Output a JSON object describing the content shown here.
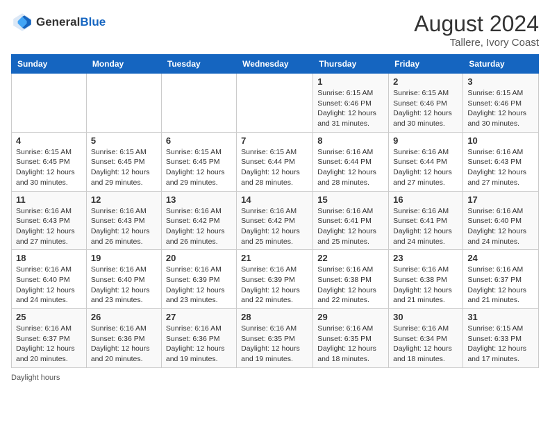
{
  "header": {
    "logo_general": "General",
    "logo_blue": "Blue",
    "month_year": "August 2024",
    "location": "Tallere, Ivory Coast"
  },
  "footer": {
    "daylight_label": "Daylight hours"
  },
  "days_of_week": [
    "Sunday",
    "Monday",
    "Tuesday",
    "Wednesday",
    "Thursday",
    "Friday",
    "Saturday"
  ],
  "weeks": [
    [
      {
        "day": "",
        "detail": ""
      },
      {
        "day": "",
        "detail": ""
      },
      {
        "day": "",
        "detail": ""
      },
      {
        "day": "",
        "detail": ""
      },
      {
        "day": "1",
        "detail": "Sunrise: 6:15 AM\nSunset: 6:46 PM\nDaylight: 12 hours and 31 minutes."
      },
      {
        "day": "2",
        "detail": "Sunrise: 6:15 AM\nSunset: 6:46 PM\nDaylight: 12 hours and 30 minutes."
      },
      {
        "day": "3",
        "detail": "Sunrise: 6:15 AM\nSunset: 6:46 PM\nDaylight: 12 hours and 30 minutes."
      }
    ],
    [
      {
        "day": "4",
        "detail": "Sunrise: 6:15 AM\nSunset: 6:45 PM\nDaylight: 12 hours and 30 minutes."
      },
      {
        "day": "5",
        "detail": "Sunrise: 6:15 AM\nSunset: 6:45 PM\nDaylight: 12 hours and 29 minutes."
      },
      {
        "day": "6",
        "detail": "Sunrise: 6:15 AM\nSunset: 6:45 PM\nDaylight: 12 hours and 29 minutes."
      },
      {
        "day": "7",
        "detail": "Sunrise: 6:15 AM\nSunset: 6:44 PM\nDaylight: 12 hours and 28 minutes."
      },
      {
        "day": "8",
        "detail": "Sunrise: 6:16 AM\nSunset: 6:44 PM\nDaylight: 12 hours and 28 minutes."
      },
      {
        "day": "9",
        "detail": "Sunrise: 6:16 AM\nSunset: 6:44 PM\nDaylight: 12 hours and 27 minutes."
      },
      {
        "day": "10",
        "detail": "Sunrise: 6:16 AM\nSunset: 6:43 PM\nDaylight: 12 hours and 27 minutes."
      }
    ],
    [
      {
        "day": "11",
        "detail": "Sunrise: 6:16 AM\nSunset: 6:43 PM\nDaylight: 12 hours and 27 minutes."
      },
      {
        "day": "12",
        "detail": "Sunrise: 6:16 AM\nSunset: 6:43 PM\nDaylight: 12 hours and 26 minutes."
      },
      {
        "day": "13",
        "detail": "Sunrise: 6:16 AM\nSunset: 6:42 PM\nDaylight: 12 hours and 26 minutes."
      },
      {
        "day": "14",
        "detail": "Sunrise: 6:16 AM\nSunset: 6:42 PM\nDaylight: 12 hours and 25 minutes."
      },
      {
        "day": "15",
        "detail": "Sunrise: 6:16 AM\nSunset: 6:41 PM\nDaylight: 12 hours and 25 minutes."
      },
      {
        "day": "16",
        "detail": "Sunrise: 6:16 AM\nSunset: 6:41 PM\nDaylight: 12 hours and 24 minutes."
      },
      {
        "day": "17",
        "detail": "Sunrise: 6:16 AM\nSunset: 6:40 PM\nDaylight: 12 hours and 24 minutes."
      }
    ],
    [
      {
        "day": "18",
        "detail": "Sunrise: 6:16 AM\nSunset: 6:40 PM\nDaylight: 12 hours and 24 minutes."
      },
      {
        "day": "19",
        "detail": "Sunrise: 6:16 AM\nSunset: 6:40 PM\nDaylight: 12 hours and 23 minutes."
      },
      {
        "day": "20",
        "detail": "Sunrise: 6:16 AM\nSunset: 6:39 PM\nDaylight: 12 hours and 23 minutes."
      },
      {
        "day": "21",
        "detail": "Sunrise: 6:16 AM\nSunset: 6:39 PM\nDaylight: 12 hours and 22 minutes."
      },
      {
        "day": "22",
        "detail": "Sunrise: 6:16 AM\nSunset: 6:38 PM\nDaylight: 12 hours and 22 minutes."
      },
      {
        "day": "23",
        "detail": "Sunrise: 6:16 AM\nSunset: 6:38 PM\nDaylight: 12 hours and 21 minutes."
      },
      {
        "day": "24",
        "detail": "Sunrise: 6:16 AM\nSunset: 6:37 PM\nDaylight: 12 hours and 21 minutes."
      }
    ],
    [
      {
        "day": "25",
        "detail": "Sunrise: 6:16 AM\nSunset: 6:37 PM\nDaylight: 12 hours and 20 minutes."
      },
      {
        "day": "26",
        "detail": "Sunrise: 6:16 AM\nSunset: 6:36 PM\nDaylight: 12 hours and 20 minutes."
      },
      {
        "day": "27",
        "detail": "Sunrise: 6:16 AM\nSunset: 6:36 PM\nDaylight: 12 hours and 19 minutes."
      },
      {
        "day": "28",
        "detail": "Sunrise: 6:16 AM\nSunset: 6:35 PM\nDaylight: 12 hours and 19 minutes."
      },
      {
        "day": "29",
        "detail": "Sunrise: 6:16 AM\nSunset: 6:35 PM\nDaylight: 12 hours and 18 minutes."
      },
      {
        "day": "30",
        "detail": "Sunrise: 6:16 AM\nSunset: 6:34 PM\nDaylight: 12 hours and 18 minutes."
      },
      {
        "day": "31",
        "detail": "Sunrise: 6:15 AM\nSunset: 6:33 PM\nDaylight: 12 hours and 17 minutes."
      }
    ]
  ]
}
